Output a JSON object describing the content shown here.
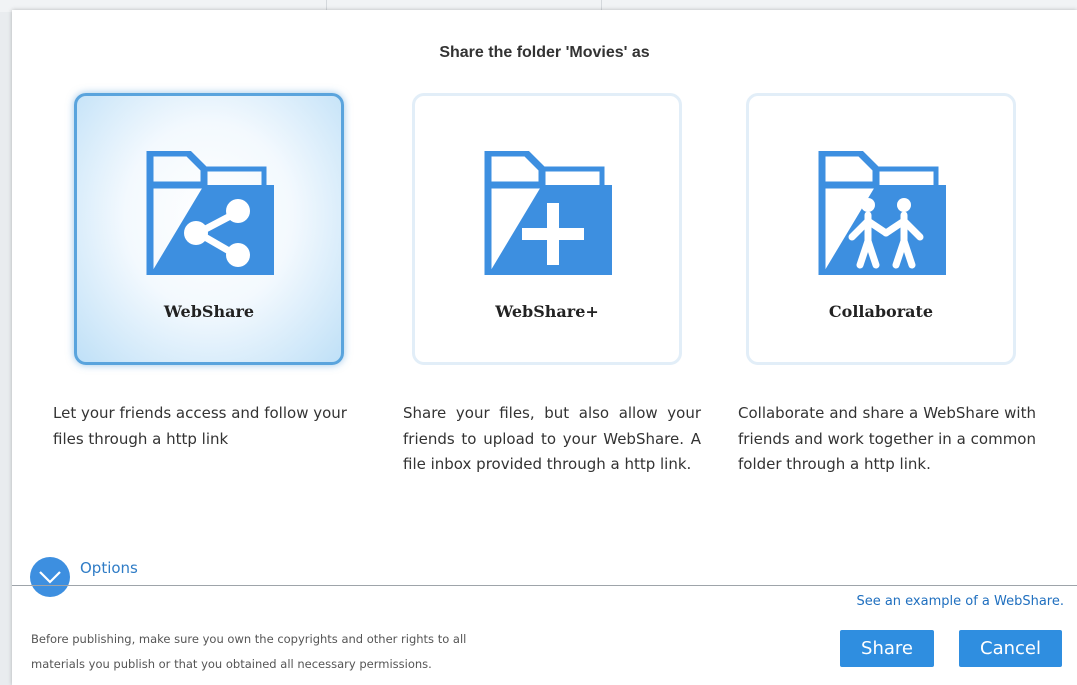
{
  "dialog": {
    "title": "Share the folder 'Movies' as"
  },
  "options_cards": [
    {
      "label": "WebShare",
      "icon": "folder-share-icon",
      "selected": true,
      "description": "Let your friends access and follow your files through a http link"
    },
    {
      "label": "WebShare+",
      "icon": "folder-plus-icon",
      "selected": false,
      "description": "Share your files, but also allow your friends to upload to your WebShare. A file inbox provided through a http link."
    },
    {
      "label": "Collaborate",
      "icon": "folder-people-icon",
      "selected": false,
      "description": "Collaborate and share a WebShare with friends and work together in a common folder through a http link."
    }
  ],
  "options_toggle": {
    "label": "Options",
    "icon": "chevron-down-icon"
  },
  "footer": {
    "example_link": "See an example of a WebShare.",
    "disclaimer_line1": "Before publishing, make sure you own the copyrights and other rights to all",
    "disclaimer_line2": "materials you publish or that you obtained all necessary permissions.",
    "share_label": "Share",
    "cancel_label": "Cancel"
  },
  "colors": {
    "accent": "#2f8ee0",
    "folder_blue": "#3d8fe0",
    "selected_border": "#5aa4dd",
    "link": "#1f6fbf"
  }
}
